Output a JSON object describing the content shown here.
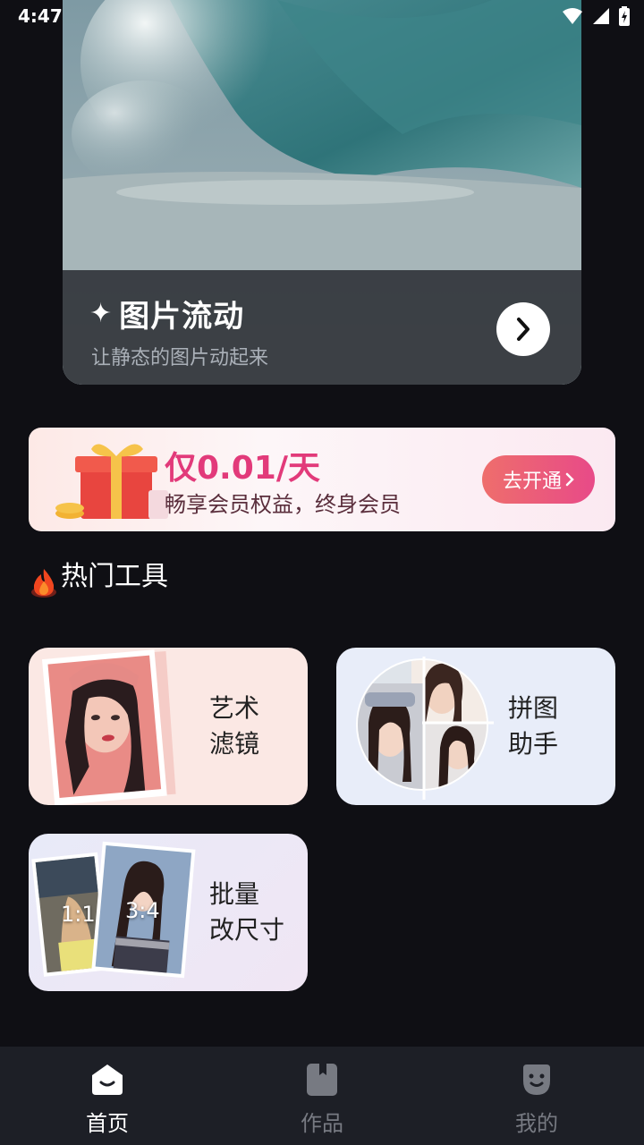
{
  "status_bar": {
    "time": "4:47"
  },
  "hero": {
    "title": "图片流动",
    "subtitle": "让静态的图片动起来"
  },
  "vip_banner": {
    "price": "仅0.01/天",
    "description": "畅享会员权益，终身会员",
    "cta": "去开通"
  },
  "hot_tools": {
    "title": "热门工具",
    "items": [
      {
        "label": "艺术\n滤镜"
      },
      {
        "label": "拼图\n助手"
      },
      {
        "label": "批量\n改尺寸",
        "ratio_a": "1:1",
        "ratio_b": "3:4"
      }
    ]
  },
  "bottom_nav": {
    "items": [
      {
        "label": "首页",
        "icon": "home-icon"
      },
      {
        "label": "作品",
        "icon": "works-icon"
      },
      {
        "label": "我的",
        "icon": "profile-icon"
      }
    ]
  }
}
